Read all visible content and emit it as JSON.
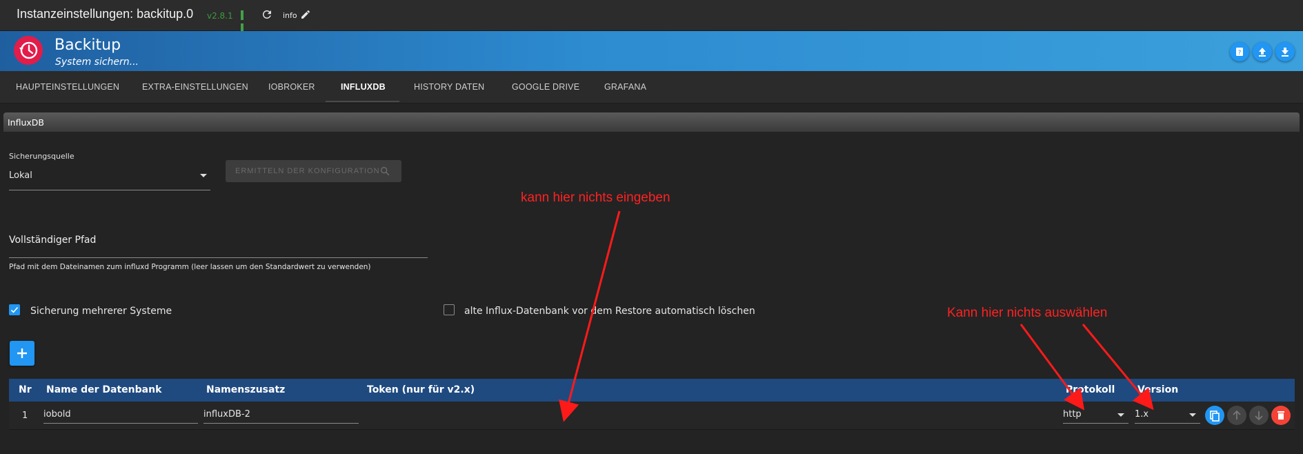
{
  "titlebar": {
    "title": "Instanzeinstellungen: backitup.0",
    "version": "v2.8.1",
    "info_label": "info"
  },
  "header": {
    "app_name": "Backitup",
    "subtitle": "System sichern..."
  },
  "tabs": [
    {
      "label": "HAUPTEINSTELLUNGEN"
    },
    {
      "label": "EXTRA-EINSTELLUNGEN"
    },
    {
      "label": "IOBROKER"
    },
    {
      "label": "INFLUXDB"
    },
    {
      "label": "HISTORY DATEN"
    },
    {
      "label": "GOOGLE DRIVE"
    },
    {
      "label": "GRAFANA"
    }
  ],
  "active_tab": "INFLUXDB",
  "section": {
    "title": "InfluxDB"
  },
  "source": {
    "label": "Sicherungsquelle",
    "value": "Lokal"
  },
  "detect_button": {
    "label": "ERMITTELN DER KONFIGURATION"
  },
  "path": {
    "label": "Vollständiger Pfad",
    "helper": "Pfad mit dem Dateinamen zum influxd Programm (leer lassen um den Standardwert zu verwenden)"
  },
  "checkboxes": [
    {
      "label": "Sicherung mehrerer Systeme",
      "checked": true
    },
    {
      "label": "alte Influx-Datenbank vor dem Restore automatisch löschen",
      "checked": false
    }
  ],
  "table": {
    "headers": {
      "nr": "Nr",
      "db_name": "Name der Datenbank",
      "suffix": "Namenszusatz",
      "token": "Token (nur für v2.x)",
      "protocol": "Protokoll",
      "version": "Version"
    },
    "rows": [
      {
        "nr": "1",
        "db_name": "iobold",
        "suffix": "influxDB-2",
        "token": "",
        "protocol": "http",
        "version": "1.x"
      }
    ]
  },
  "annotations": {
    "note_input": "kann hier nichts eingeben",
    "note_select": "Kann hier nichts auswählen"
  },
  "colors": {
    "accent": "#2196f3",
    "banner_start": "#1f5fa0",
    "banner_end": "#3ba0dc",
    "logo": "#e21d4a",
    "table_header": "#1f4a80",
    "annotation": "#ff2222",
    "delete": "#f44336"
  }
}
